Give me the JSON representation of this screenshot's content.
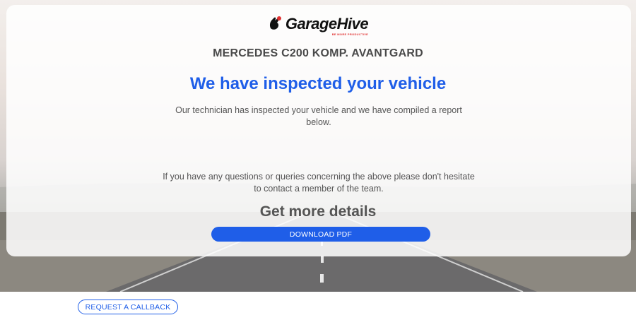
{
  "brand": {
    "logo_text": "GarageHive",
    "tagline": "BE MORE PRODUCTIVE"
  },
  "vehicle": {
    "name": "MERCEDES C200 KOMP. AVANTGARD"
  },
  "main": {
    "headline": "We have inspected your vehicle",
    "intro": "Our technician has inspected your vehicle and we have compiled a report below.",
    "contact_note": "If you have any questions or queries concerning the above please don't hesitate to contact a member of the team.",
    "details_heading": "Get more details",
    "download_label": "DOWNLOAD PDF"
  },
  "footer": {
    "callback_label": "REQUEST A CALLBACK"
  },
  "colors": {
    "accent": "#1f5ee8",
    "heading_gray": "#555555",
    "logo_red": "#e03030"
  }
}
